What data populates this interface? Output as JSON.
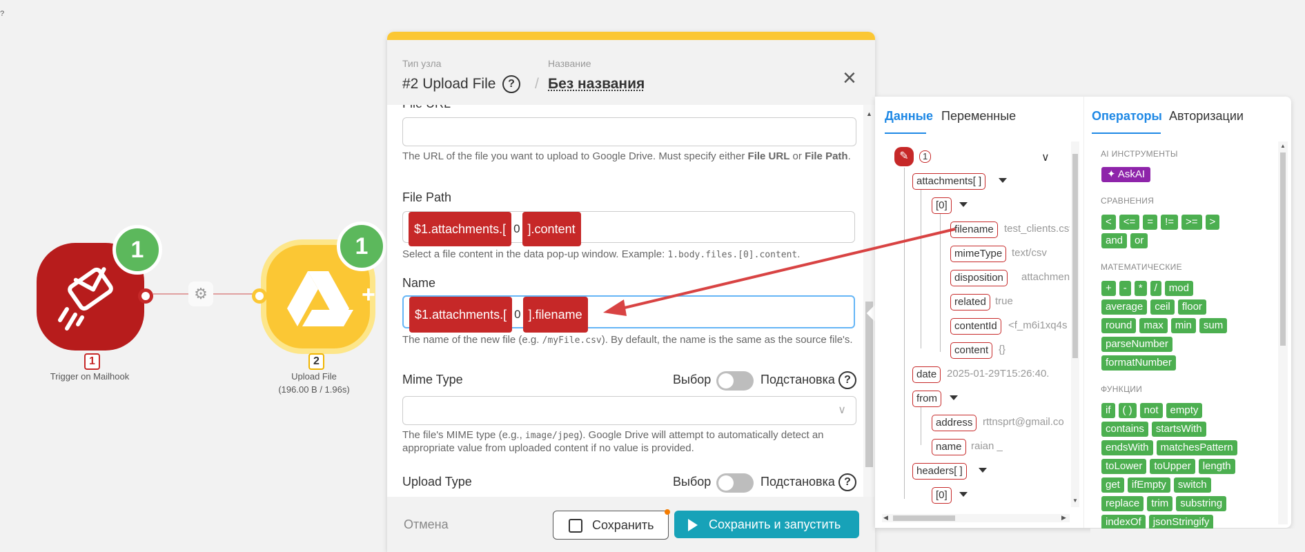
{
  "canvas": {
    "node1": {
      "number": "1",
      "label": "Trigger on Mailhook",
      "badge": "1"
    },
    "node2": {
      "number": "2",
      "label": "Upload File",
      "stats": "(196.00 B / 1.96s)",
      "badge": "1"
    }
  },
  "panel": {
    "type_label": "Тип узла",
    "type_value": "#2 Upload File",
    "name_label": "Название",
    "name_value": "Без названия",
    "file_url_label": "File URL",
    "file_url_help_1": "The URL of the file you want to upload to Google Drive. Must specify either ",
    "file_url_help_b1": "File URL",
    "file_url_help_2": " or ",
    "file_url_help_b2": "File Path",
    "file_url_help_3": ".",
    "file_path_label": "File Path",
    "file_path_chip1": "$1.attachments.[",
    "file_path_idx": "0",
    "file_path_chip2": "].content",
    "file_path_help_1": "Select a file content in the data pop-up window. Example: ",
    "file_path_help_code": "1.body.files.[0].content",
    "file_path_help_2": ".",
    "name_field_label": "Name",
    "name_chip1": "$1.attachments.[",
    "name_idx": "0",
    "name_chip2": "].filename",
    "name_help_1": "The name of the new file (e.g. ",
    "name_help_code": "/myFile.csv",
    "name_help_2": "). By default, the name is the same as the source file's.",
    "mime_label": "Mime Type",
    "choice_label": "Выбор",
    "subst_label": "Подстановка",
    "mime_help_1": "The file's MIME type (e.g., ",
    "mime_help_code": "image/jpeg",
    "mime_help_2": "). Google Drive will attempt to automatically detect an appropriate value from uploaded content if no value is provided.",
    "upload_type_label": "Upload Type",
    "cancel": "Отмена",
    "save": "Сохранить",
    "save_run": "Сохранить и запустить"
  },
  "data_panel": {
    "tab_data": "Данные",
    "tab_vars": "Переменные",
    "tab_ops": "Операторы",
    "tab_auth": "Авторизации",
    "root_num": "1",
    "tree": [
      {
        "key": "attachments[ ]"
      },
      {
        "key": "[0]"
      },
      {
        "key": "filename",
        "value": "test_clients.csv"
      },
      {
        "key": "mimeType",
        "value": "text/csv"
      },
      {
        "key": "disposition",
        "value": "attachment"
      },
      {
        "key": "related",
        "value": "true"
      },
      {
        "key": "contentId",
        "value": "<f_m6i1xq4s"
      },
      {
        "key": "content",
        "value": "{}"
      },
      {
        "key": "date",
        "value": "2025-01-29T15:26:40."
      },
      {
        "key": "from"
      },
      {
        "key": "address",
        "value": "rttnsprt@gmail.co"
      },
      {
        "key": "name",
        "value": "raian _"
      },
      {
        "key": "headers[ ]"
      },
      {
        "key": "[0]"
      }
    ]
  },
  "operators": {
    "ai_title": "AI ИНСТРУМЕНТЫ",
    "askai": "AskAI",
    "cmp_title": "СРАВНЕНИЯ",
    "cmp": [
      "<",
      "<=",
      "=",
      "!=",
      ">=",
      ">",
      "and",
      "or"
    ],
    "math_title": "МАТЕМАТИЧЕСКИЕ",
    "math": [
      "+",
      "-",
      "*",
      "/",
      "mod",
      "average",
      "ceil",
      "floor",
      "round",
      "max",
      "min",
      "sum",
      "parseNumber",
      "formatNumber"
    ],
    "fn_title": "ФУНКЦИИ",
    "fn": [
      "if",
      "( )",
      "not",
      "empty",
      "contains",
      "startsWith",
      "endsWith",
      "matchesPattern",
      "toLower",
      "toUpper",
      "length",
      "get",
      "ifEmpty",
      "switch",
      "replace",
      "trim",
      "substring",
      "indexOf",
      "jsonStringify"
    ]
  },
  "colors": {
    "accent": "#1e88e5",
    "chip": "#c62828",
    "op": "#4caf50",
    "primary_btn": "#17a2b8"
  }
}
